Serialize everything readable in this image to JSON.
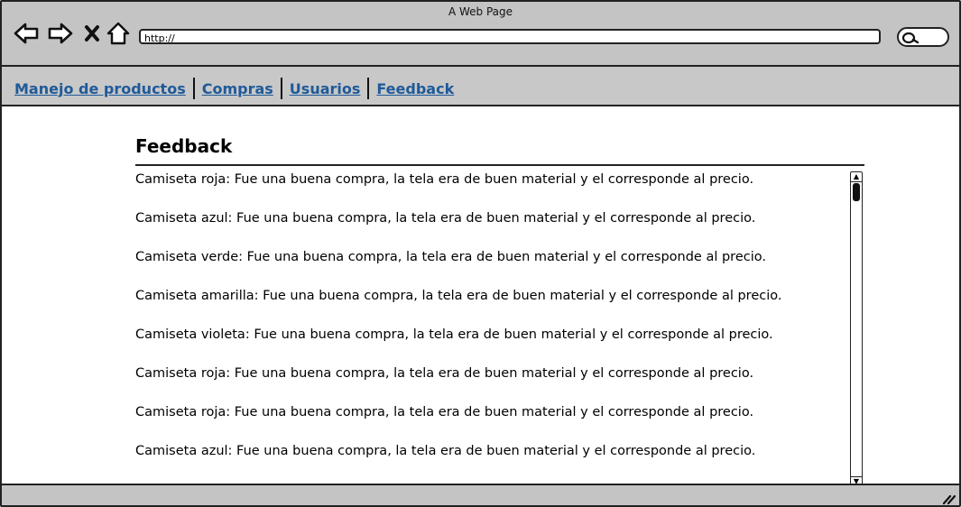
{
  "window": {
    "title": "A Web Page"
  },
  "browser": {
    "url": "http://",
    "icons": [
      "back-arrow-icon",
      "forward-arrow-icon",
      "close-x-icon",
      "home-icon",
      "search-icon"
    ]
  },
  "menu": {
    "items": [
      {
        "label": "Manejo de productos"
      },
      {
        "label": "Compras"
      },
      {
        "label": "Usuarios"
      },
      {
        "label": "Feedback"
      }
    ],
    "link_color": "#1f5a99"
  },
  "main": {
    "title": "Feedback",
    "entries": [
      "Camiseta roja: Fue una buena compra, la tela era de buen material y el corresponde al precio.",
      "Camiseta azul: Fue una buena compra, la tela era de buen material y el corresponde al precio.",
      "Camiseta verde: Fue una buena compra, la tela era de buen material y el corresponde al precio.",
      "Camiseta amarilla: Fue una buena compra, la tela era de buen material y el corresponde al precio.",
      "Camiseta violeta: Fue una buena compra, la tela era de buen material y el corresponde al precio.",
      "Camiseta roja: Fue una buena compra, la tela era de buen material y el corresponde al precio.",
      "Camiseta roja: Fue una buena compra, la tela era de buen material y el corresponde al precio.",
      "Camiseta azul: Fue una buena compra, la tela era de buen material y el corresponde al precio."
    ]
  }
}
